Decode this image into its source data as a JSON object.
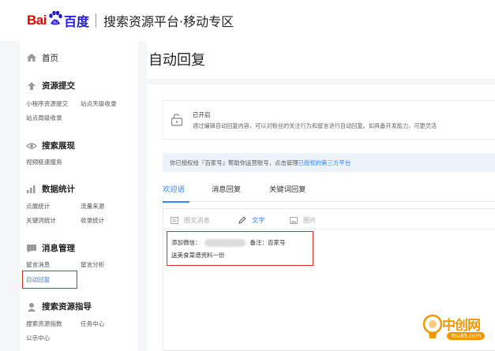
{
  "header": {
    "logo_text_bai": "Bai",
    "logo_text_du": "百度",
    "platform_title": "搜索资源平台·移动专区"
  },
  "sidebar": {
    "home_label": "首页",
    "sections": [
      {
        "title": "资源提交",
        "icon": "upload-icon",
        "items": [
          "小程序资源提交",
          "站点天级收录",
          "站点周级收录"
        ]
      },
      {
        "title": "搜索展现",
        "icon": "eye-icon",
        "items": [
          "视频极速服务"
        ]
      },
      {
        "title": "数据统计",
        "icon": "chart-icon",
        "items": [
          "点展统计",
          "流量来源",
          "关键词统计",
          "收录统计"
        ]
      },
      {
        "title": "消息管理",
        "icon": "message-icon",
        "items": [
          "留言消息",
          "留言分析",
          "自动回复"
        ]
      },
      {
        "title": "搜索资源指导",
        "icon": "person-icon",
        "items": [
          "搜索资源指数",
          "任务中心",
          "公示中心"
        ]
      }
    ]
  },
  "main": {
    "page_title": "自动回复",
    "status": {
      "title": "已开启",
      "description": "通过编辑自动回复内容，可以对粉丝的关注行为和留言进行自动回复。如具备开发能力，可更灵活"
    },
    "auth_notice": {
      "text": "你已授权给『百家号』帮助你运营账号，点击管理",
      "link": "已授权的第三方平台"
    },
    "tabs": [
      "欢迎语",
      "消息回复",
      "关键词回复"
    ],
    "active_tab": 0,
    "toolbar": {
      "image_text": "图文消息",
      "text": "文字",
      "image": "图片"
    },
    "editor_content": {
      "line1_prefix": "添加微信：",
      "line1_note": "备注：百家号",
      "line2": "送美食菜谱资料一份"
    }
  },
  "watermark": {
    "name": "中创网",
    "url": "You85.com"
  },
  "colors": {
    "accent": "#3385ff",
    "highlight_box": "#e02a2a",
    "brand_red": "#e10601",
    "brand_blue": "#2319dc"
  }
}
